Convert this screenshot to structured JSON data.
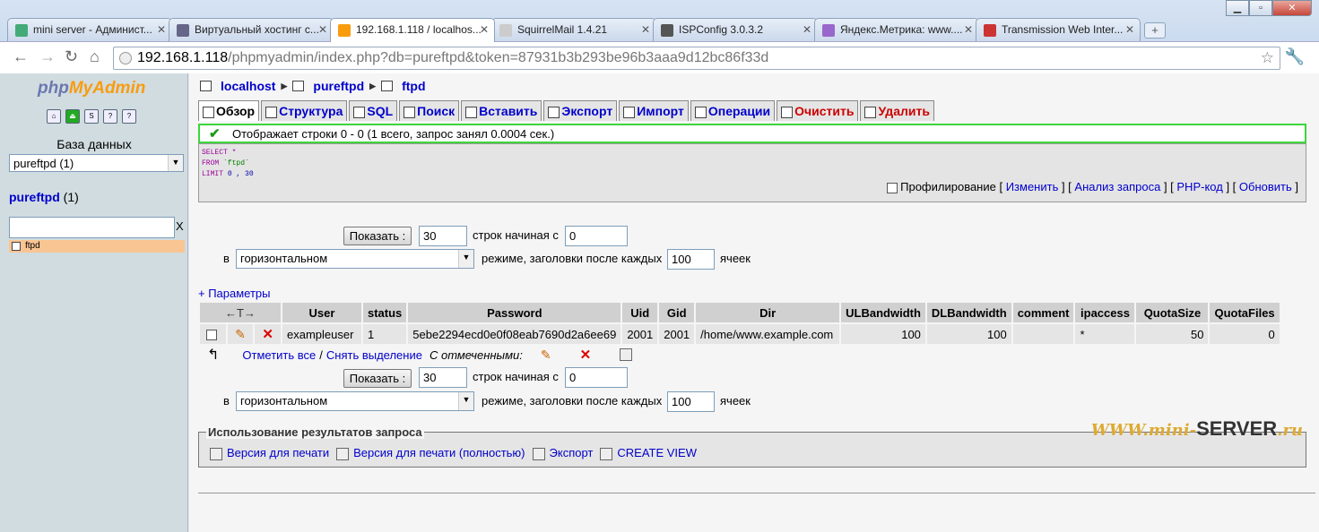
{
  "browser": {
    "tabs": [
      {
        "title": "mini server - Админист...",
        "color": "#4a7"
      },
      {
        "title": "Виртуальный хостинг с...",
        "color": "#668"
      },
      {
        "title": "192.168.1.118 / localhos...",
        "color": "#f89c0e"
      },
      {
        "title": "SquirrelMail 1.4.21",
        "color": "#ccc"
      },
      {
        "title": "ISPConfig 3.0.3.2",
        "color": "#555"
      },
      {
        "title": "Яндекс.Метрика: www....",
        "color": "#96c"
      },
      {
        "title": "Transmission Web Inter...",
        "color": "#c33"
      }
    ],
    "url_host": "192.168.1.118",
    "url_path": "/phpmyadmin/index.php?db=pureftpd&token=87931b3b293be96b3aaa9d12bc86f33d"
  },
  "sidebar": {
    "logo_php": "php",
    "logo_my": "MyAdmin",
    "db_label": "База данных",
    "db_select": "pureftpd (1)",
    "db_name": "pureftpd",
    "db_count": "(1)",
    "filter_clear": "X",
    "table_item": "ftpd"
  },
  "breadcrumb": {
    "server": "localhost",
    "db": "pureftpd",
    "table": "ftpd"
  },
  "tabs": [
    {
      "label": "Обзор"
    },
    {
      "label": "Структура"
    },
    {
      "label": "SQL"
    },
    {
      "label": "Поиск"
    },
    {
      "label": "Вставить"
    },
    {
      "label": "Экспорт"
    },
    {
      "label": "Импорт"
    },
    {
      "label": "Операции"
    },
    {
      "label": "Очистить"
    },
    {
      "label": "Удалить"
    }
  ],
  "notice": "Отображает строки 0 - 0 (1 всего, запрос занял 0.0004 сек.)",
  "sql": {
    "select_kw": "SELECT",
    "select_val": " *",
    "from_kw": "FROM",
    "from_val": " `ftpd`",
    "limit_kw": "LIMIT",
    "limit_val": " 0 , 30",
    "profiling": "Профилирование",
    "edit": "Изменить",
    "explain": "Анализ запроса",
    "phpcode": "PHP-код",
    "refresh": "Обновить"
  },
  "nav": {
    "show_button": "Показать :",
    "rows": "30",
    "rows_label": "строк начиная с",
    "start": "0",
    "in_label": "в",
    "mode": "горизонтальном",
    "mode_label": "режиме, заголовки после каждых",
    "headers_every": "100",
    "cells_label": "ячеек"
  },
  "params_link": "+ Параметры",
  "table": {
    "sort_arrows": "←T→",
    "headers": [
      "User",
      "status",
      "Password",
      "Uid",
      "Gid",
      "Dir",
      "ULBandwidth",
      "DLBandwidth",
      "comment",
      "ipaccess",
      "QuotaSize",
      "QuotaFiles"
    ],
    "row": [
      "exampleuser",
      "1",
      "5ebe2294ecd0e0f08eab7690d2a6ee69",
      "2001",
      "2001",
      "/home/www.example.com",
      "100",
      "100",
      "",
      "*",
      "50",
      "0"
    ]
  },
  "mark": {
    "check_all": "Отметить все",
    "sep": " / ",
    "uncheck_all": "Снять выделение",
    "with_selected": "С отмеченными:"
  },
  "query_results": {
    "legend": "Использование результатов запроса",
    "print": "Версия для печати",
    "print_full": "Версия для печати (полностью)",
    "export": "Экспорт",
    "create_view": "CREATE VIEW"
  },
  "watermark": {
    "www": "WWW.",
    "mini": "mini-",
    "server": "SERVER",
    "ru": ".ru"
  }
}
